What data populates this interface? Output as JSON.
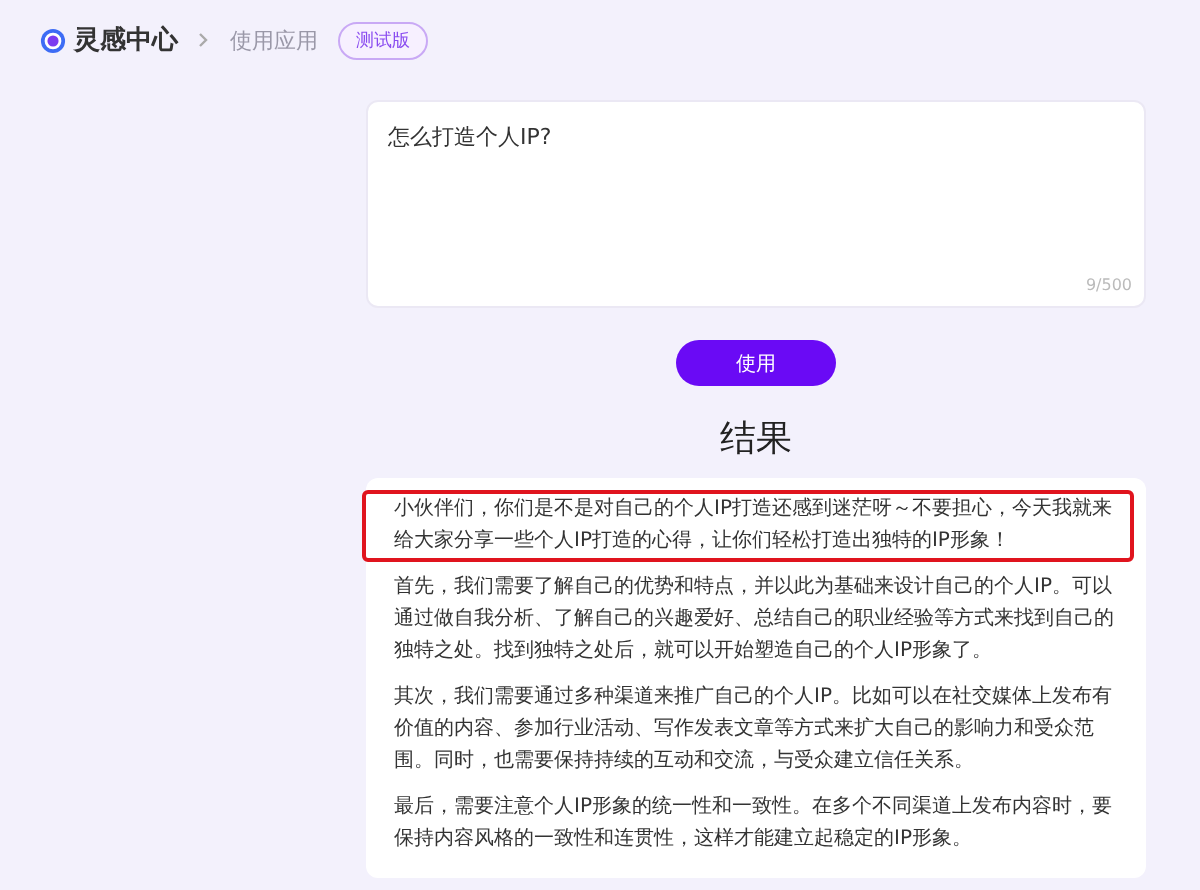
{
  "header": {
    "app_name": "灵感中心",
    "breadcrumb": "使用应用",
    "badge": "测试版"
  },
  "prompt": {
    "value": "怎么打造个人IP?",
    "counter": "9/500"
  },
  "submit_button": "使用",
  "result": {
    "title": "结果",
    "paragraphs": [
      {
        "text": "小伙伴们，你们是不是对自己的个人IP打造还感到迷茫呀～不要担心，今天我就来给大家分享一些个人IP打造的心得，让你们轻松打造出独特的IP形象！",
        "highlighted": true
      },
      {
        "text": "首先，我们需要了解自己的优势和特点，并以此为基础来设计自己的个人IP。可以通过做自我分析、了解自己的兴趣爱好、总结自己的职业经验等方式来找到自己的独特之处。找到独特之处后，就可以开始塑造自己的个人IP形象了。",
        "highlighted": false
      },
      {
        "text": "其次，我们需要通过多种渠道来推广自己的个人IP。比如可以在社交媒体上发布有价值的内容、参加行业活动、写作发表文章等方式来扩大自己的影响力和受众范围。同时，也需要保持持续的互动和交流，与受众建立信任关系。",
        "highlighted": false
      },
      {
        "text": "最后，需要注意个人IP形象的统一性和一致性。在多个不同渠道上发布内容时，要保持内容风格的一致性和连贯性，这样才能建立起稳定的IP形象。",
        "highlighted": false
      }
    ]
  }
}
